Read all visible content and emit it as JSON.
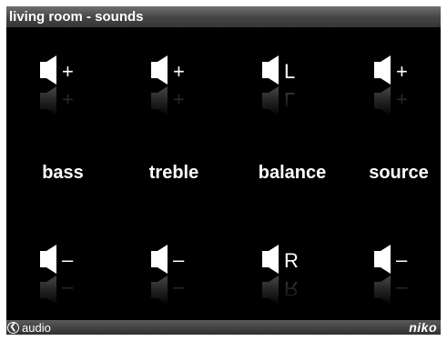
{
  "header": {
    "title": "living room - sounds"
  },
  "labels": {
    "bass": "bass",
    "treble": "treble",
    "balance": "balance",
    "source": "source"
  },
  "buttons": {
    "bass_up": "+",
    "treble_up": "+",
    "balance_left": "L",
    "source_up": "+",
    "bass_down": "–",
    "treble_down": "–",
    "balance_right": "R",
    "source_down": "–"
  },
  "footer": {
    "back_label": "audio",
    "brand": "niko"
  },
  "icons": {
    "speaker": "speaker-icon",
    "back": "back-arrow-icon"
  },
  "colors": {
    "background": "#000000",
    "text": "#ffffff",
    "bar": "#444444"
  }
}
